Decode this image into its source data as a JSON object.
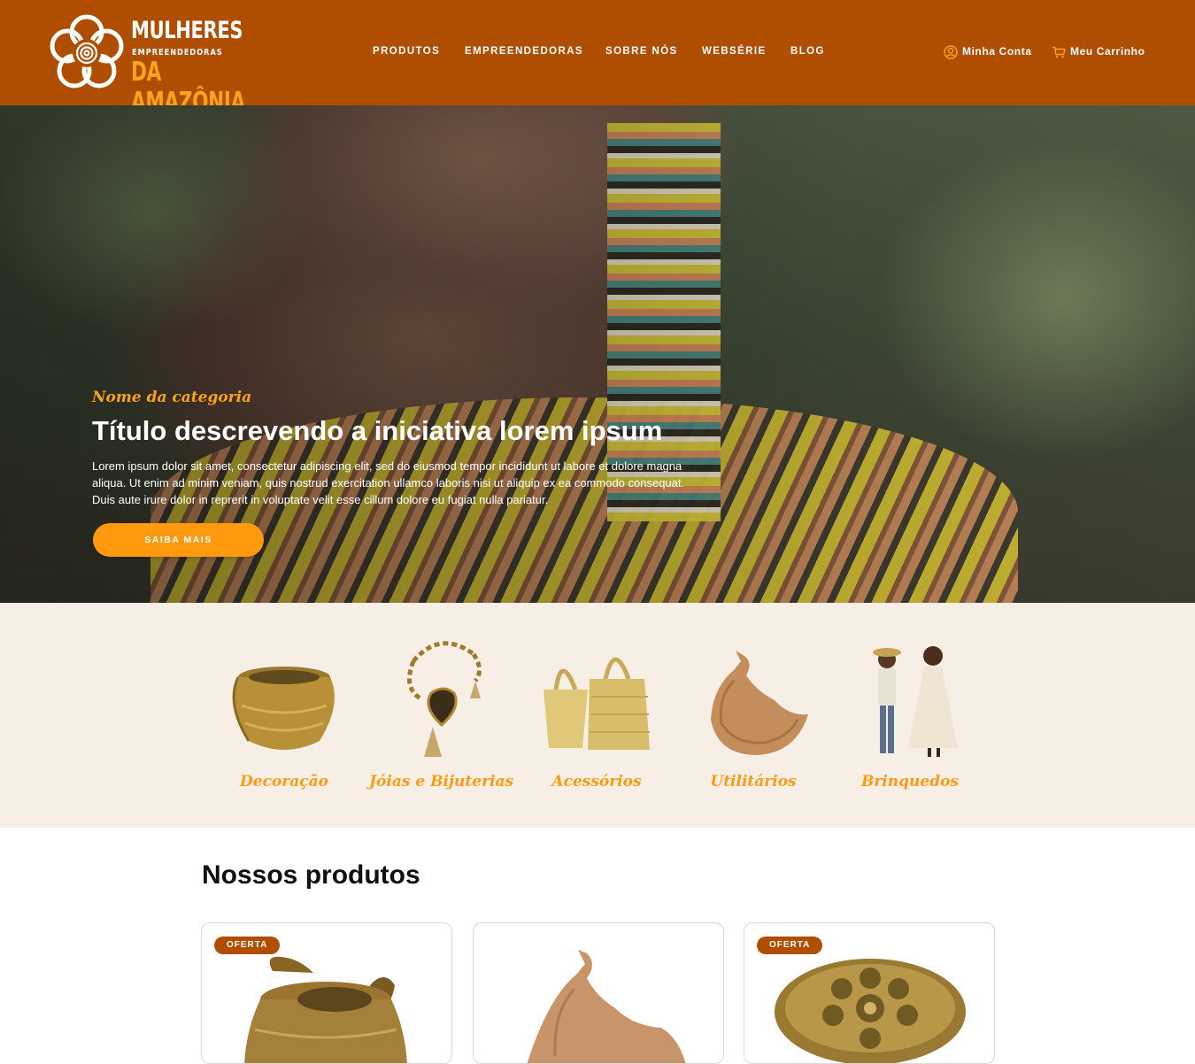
{
  "brand": {
    "line1": "MULHERES",
    "line2": "EMPREENDEDORAS",
    "line3": "DA AMAZÔNIA"
  },
  "nav": {
    "items": [
      {
        "label": "PRODUTOS"
      },
      {
        "label": "EMPREENDEDORAS"
      },
      {
        "label": "SOBRE NÓS"
      },
      {
        "label": "WEBSÉRIE"
      },
      {
        "label": "BLOG"
      }
    ]
  },
  "account": {
    "account_label": "Minha Conta",
    "account_icon": "user-circle-icon",
    "cart_label": "Meu Carrinho",
    "cart_icon": "shopping-cart-icon"
  },
  "hero": {
    "category": "Nome da categoria",
    "title": "Título descrevendo a iniciativa lorem ipsum",
    "text": "Lorem ipsum dolor sit amet, consectetur adipiscing elit, sed do eiusmod tempor incididunt ut labore et dolore magna aliqua. Ut enim ad minim veniam, quis nostrud exercitation ullamco laboris nisi ut aliquip ex ea commodo consequat. Duis aute irure dolor in reprerit in voluptate velit esse cillum dolore eu fugiat nulla pariatur.",
    "button": "SAIBA MAIS"
  },
  "categories": [
    {
      "label": "Decoração"
    },
    {
      "label": "Jóias e Bijuterias"
    },
    {
      "label": "Acessórios"
    },
    {
      "label": "Utilitários"
    },
    {
      "label": "Brinquedos"
    }
  ],
  "products": {
    "title": "Nossos produtos",
    "cards": [
      {
        "badge": "OFERTA"
      },
      {
        "badge": ""
      },
      {
        "badge": "OFERTA"
      }
    ]
  },
  "colors": {
    "header_bg": "#b04e00",
    "accent_orange": "#ff9a0f",
    "category_bg": "#f7efe5"
  }
}
